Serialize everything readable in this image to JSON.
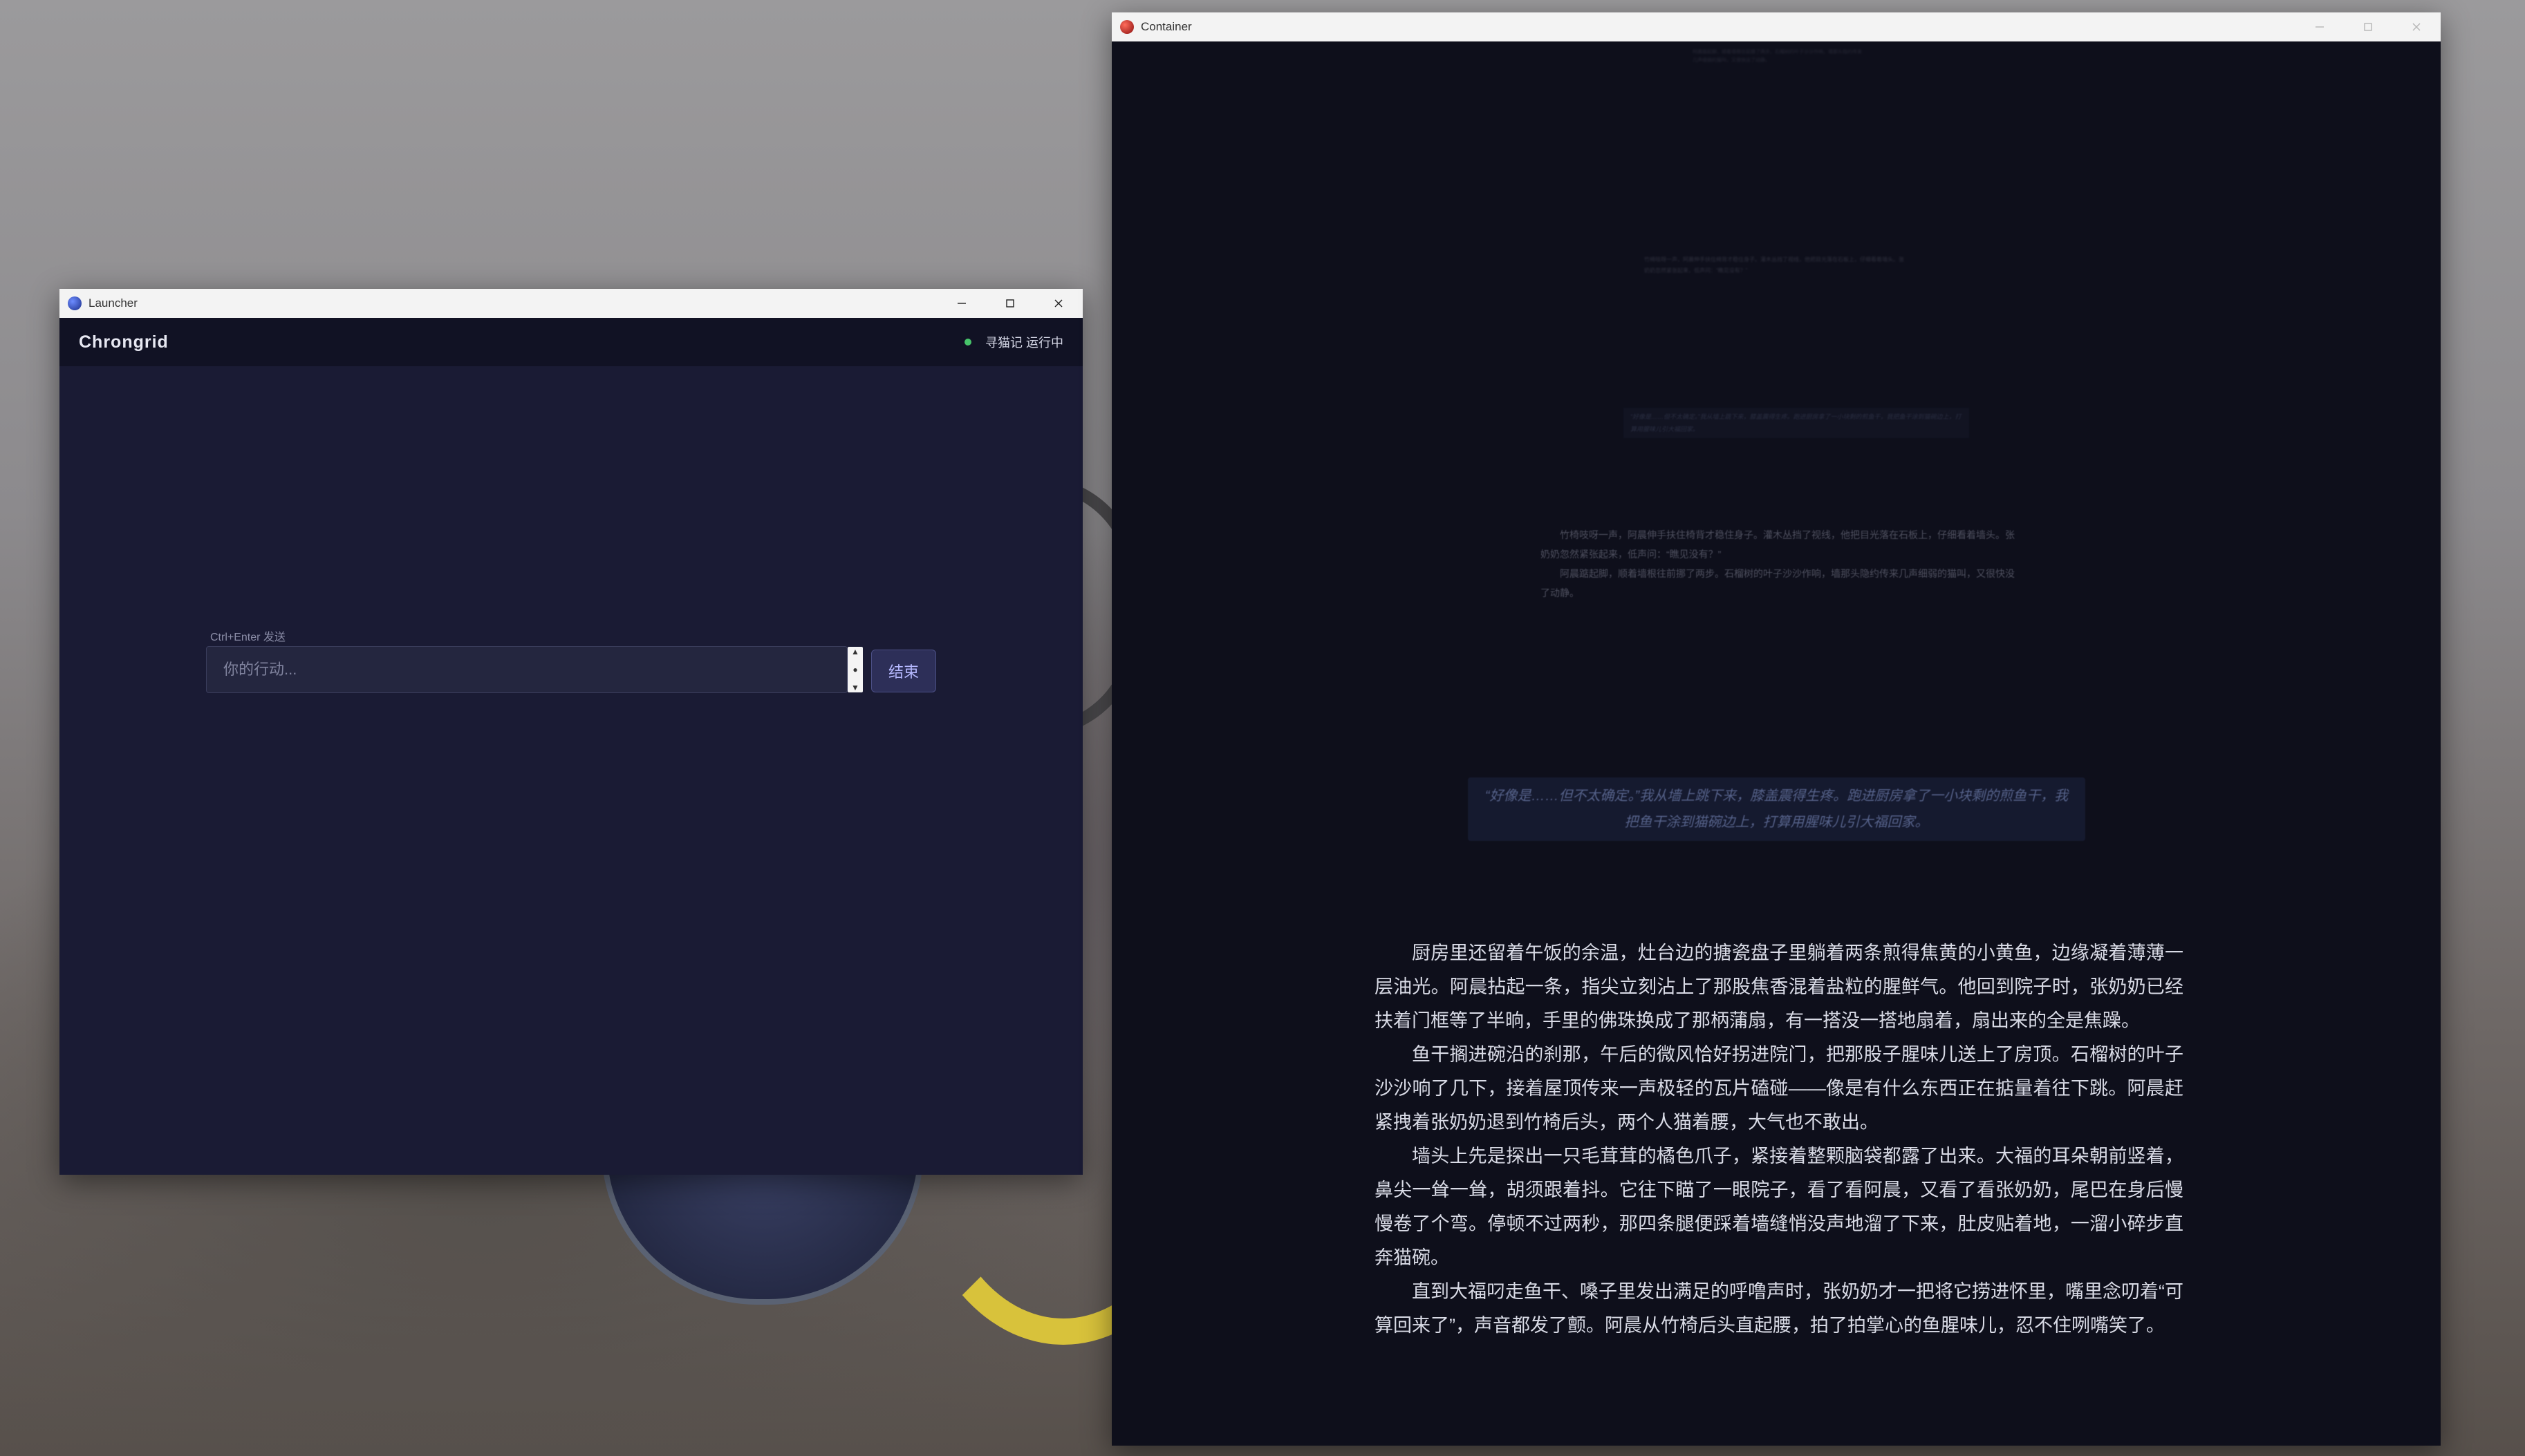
{
  "launcher": {
    "window_title": "Launcher",
    "brand": "Chrongrid",
    "status_text": "寻猫记 运行中",
    "input_hint": "Ctrl+Enter 发送",
    "input_placeholder": "你的行动...",
    "input_value": "",
    "end_button_label": "结束",
    "status_color": "#47c46a"
  },
  "container": {
    "window_title": "Container",
    "faded_paragraphs": [
      "竹椅吱呀一声，阿晨伸手扶住椅背才稳住身子。灌木丛挡了视线，他把目光落在石板上，仔细看着墙头。张奶奶忽然紧张起来，低声问：“瞧见没有？”",
      "阿晨踮起脚，顺着墙根往前挪了两步。石榴树的叶子沙沙作响，墙那头隐约传来几声细弱的猫叫，又很快没了动静。"
    ],
    "faded_choice": "“好像是……但不太确定。”我从墙上跳下来，膝盖震得生疼。跑进厨房拿了一小块剩的煎鱼干，我把鱼干涂到猫碗边上，打算用腥味儿引大福回家。",
    "story_paragraphs": [
      "厨房里还留着午饭的余温，灶台边的搪瓷盘子里躺着两条煎得焦黄的小黄鱼，边缘凝着薄薄一层油光。阿晨拈起一条，指尖立刻沾上了那股焦香混着盐粒的腥鲜气。他回到院子时，张奶奶已经扶着门框等了半晌，手里的佛珠换成了那柄蒲扇，有一搭没一搭地扇着，扇出来的全是焦躁。",
      "鱼干搁进碗沿的刹那，午后的微风恰好拐进院门，把那股子腥味儿送上了房顶。石榴树的叶子沙沙响了几下，接着屋顶传来一声极轻的瓦片磕碰——像是有什么东西正在掂量着往下跳。阿晨赶紧拽着张奶奶退到竹椅后头，两个人猫着腰，大气也不敢出。",
      "墙头上先是探出一只毛茸茸的橘色爪子，紧接着整颗脑袋都露了出来。大福的耳朵朝前竖着，鼻尖一耸一耸，胡须跟着抖。它往下瞄了一眼院子，看了看阿晨，又看了看张奶奶，尾巴在身后慢慢卷了个弯。停顿不过两秒，那四条腿便踩着墙缝悄没声地溜了下来，肚皮贴着地，一溜小碎步直奔猫碗。",
      "直到大福叼走鱼干、嗓子里发出满足的呼噜声时，张奶奶才一把将它捞进怀里，嘴里念叨着“可算回来了”，声音都发了颤。阿晨从竹椅后头直起腰，拍了拍掌心的鱼腥味儿，忍不住咧嘴笑了。"
    ]
  },
  "colors": {
    "app_background": "#1a1b34",
    "header_background": "#111224",
    "accent": "#b6b9ff"
  }
}
